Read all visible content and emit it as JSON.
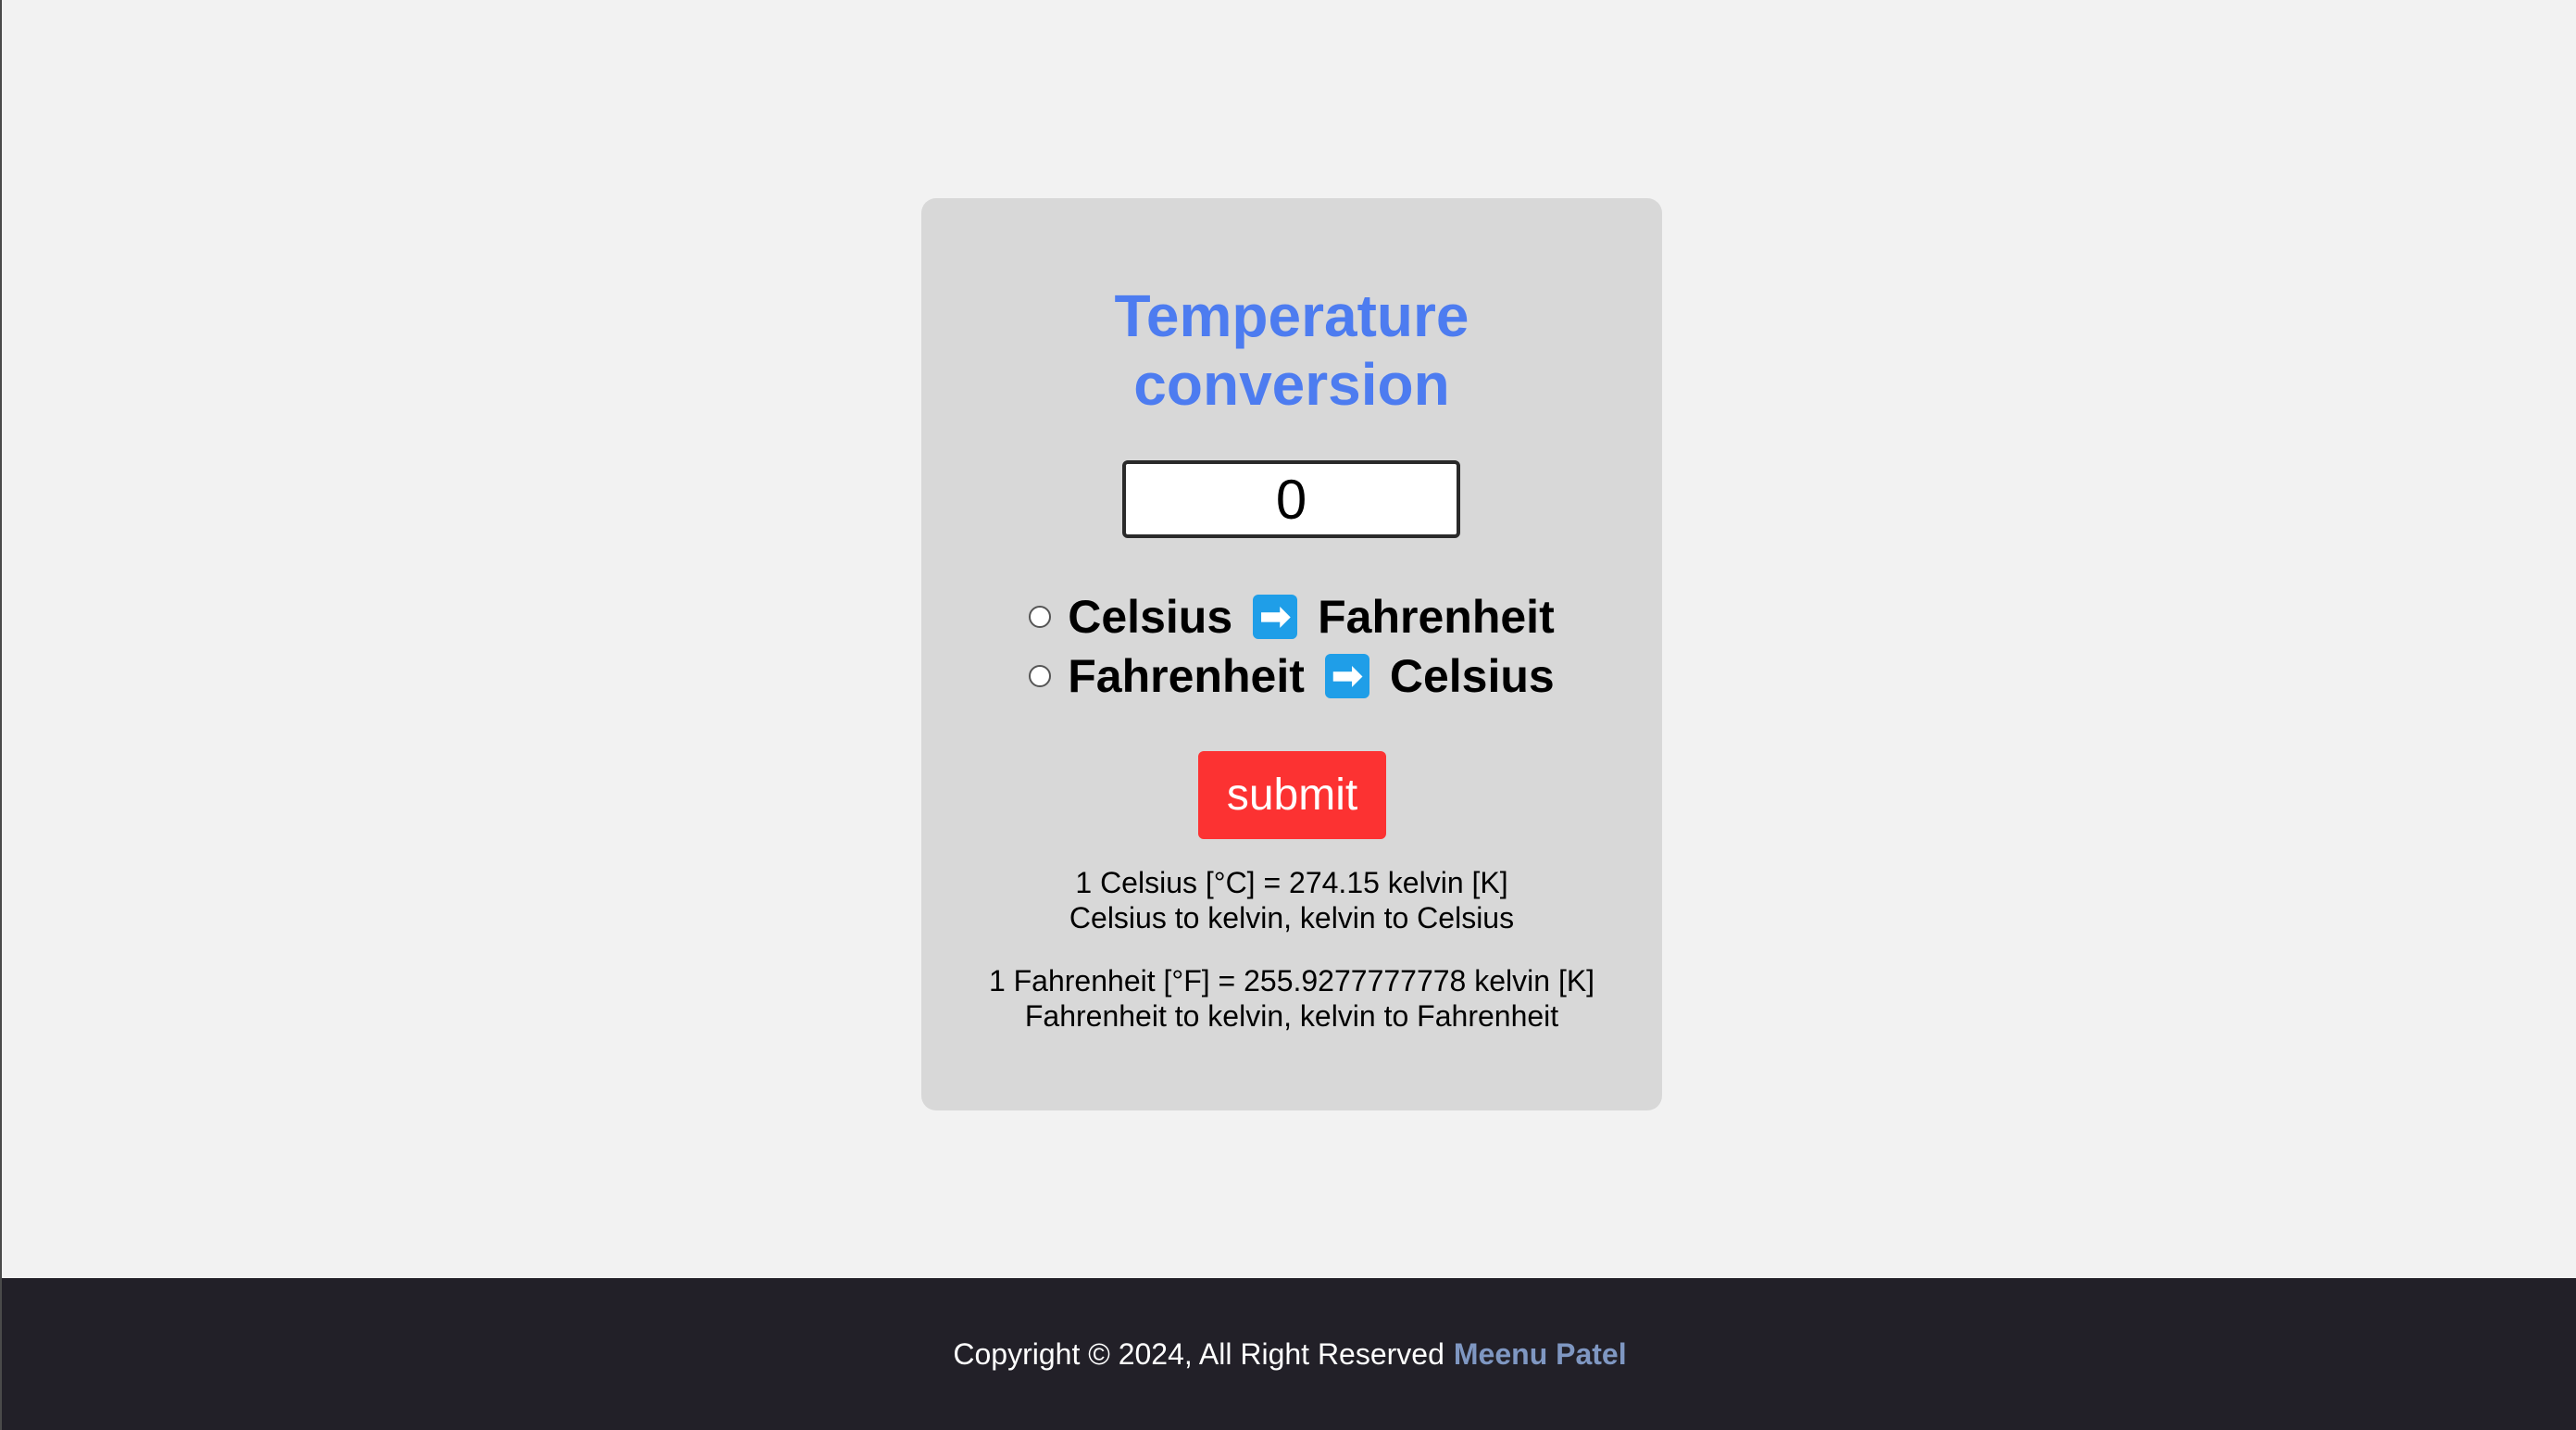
{
  "card": {
    "title_line1": "Temperature",
    "title_line2": "conversion",
    "input_value": "0",
    "options": [
      {
        "from": "Celsius",
        "to": "Fahrenheit"
      },
      {
        "from": "Fahrenheit",
        "to": "Celsius"
      }
    ],
    "arrow_glyph": "➡",
    "submit_label": "submit",
    "info": [
      {
        "line1": "1 Celsius [°C] = 274.15 kelvin [K]",
        "line2": "Celsius to kelvin, kelvin to Celsius"
      },
      {
        "line1": "1 Fahrenheit [°F] = 255.9277777778 kelvin [K]",
        "line2": "Fahrenheit to kelvin, kelvin to Fahrenheit"
      }
    ]
  },
  "footer": {
    "copyright": "Copyright © 2024, All Right Reserved",
    "author": "Meenu Patel"
  },
  "colors": {
    "title": "#4d7cf0",
    "submit": "#fc3232",
    "arrow": "#1f9ee8",
    "footer_bg": "#222028",
    "author": "#7f97c2"
  },
  "icons": [
    "arrow-right-icon"
  ]
}
